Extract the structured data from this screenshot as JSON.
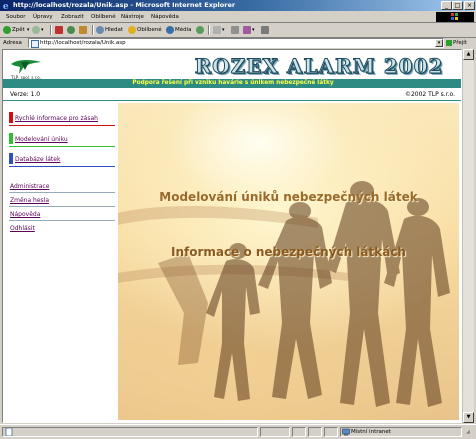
{
  "window": {
    "title": "http://localhost/rozala/Unik.asp - Microsoft Internet Explorer",
    "buttons": {
      "minimize": "_",
      "maximize": "□",
      "close": "×"
    }
  },
  "menu": [
    "Soubor",
    "Úpravy",
    "Zobrazit",
    "Oblíbené",
    "Nástroje",
    "Nápověda"
  ],
  "toolbar": {
    "back": "Zpět",
    "search": "Hledat",
    "favorites": "Oblíbené",
    "media": "Média"
  },
  "address": {
    "label": "Adresa",
    "url": "http://localhost/rozala/Unik.asp",
    "go": "Přejít"
  },
  "page": {
    "logo_text": "TLP, spol. s r.o.",
    "banner": "ROZEX ALARM 2002",
    "subtitle": "Podpora řešení při vzniku havárie s únikem nebezpečné látky",
    "version": "Verze: 1.0",
    "copyright": "©2002 TLP s.r.o."
  },
  "nav": {
    "primary": [
      {
        "label": "Rychlé informace pro zásah",
        "color": "#d01010"
      },
      {
        "label": "Modelování úniku",
        "color": "#30c030"
      },
      {
        "label": "Databáze látek",
        "color": "#3050c0"
      }
    ],
    "secondary": [
      "Administrace",
      "Změna hesla",
      "Nápověda",
      "Odhlásit"
    ]
  },
  "hero": {
    "line1": "Modelování úniků nebezpečných látek",
    "line2": "Informace o nebezpečných látkách"
  },
  "status": {
    "zone": "Místní intranet"
  },
  "colors": {
    "accent": "#2e8b83",
    "subtitle_text": "#ffff44",
    "link": "#5a005a"
  }
}
